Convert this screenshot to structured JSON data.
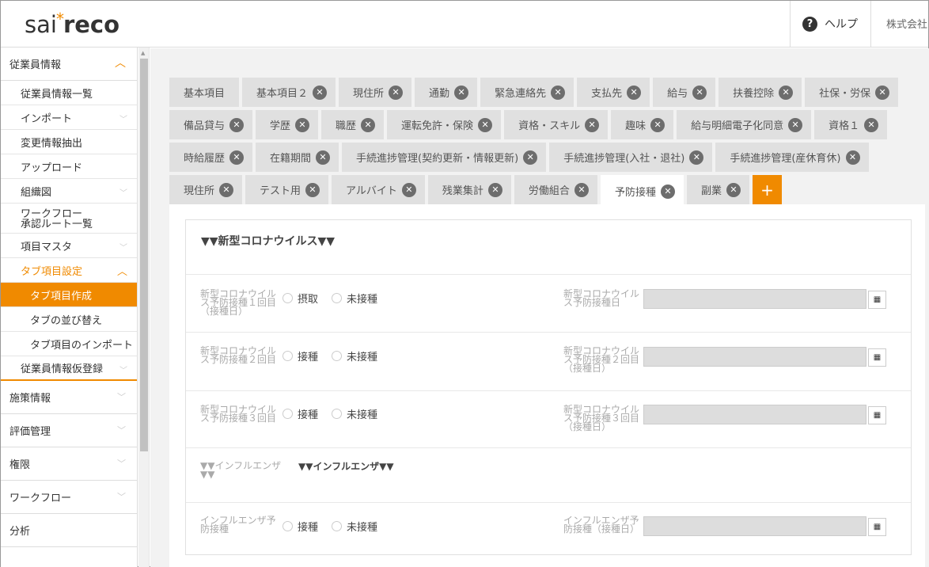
{
  "header": {
    "logo_light": "sai",
    "logo_star": "*",
    "logo_bold": "reco",
    "help_icon": "?",
    "help_label": "ヘルプ",
    "company": "株式会社"
  },
  "sidebar": {
    "group_employee": "従業員情報",
    "items": [
      "従業員情報一覧",
      "インポート",
      "変更情報抽出",
      "アップロード",
      "組織図",
      "ワークフロー\n承認ルート一覧",
      "項目マスタ",
      "タブ項目設定"
    ],
    "workflow_line1": "ワークフロー",
    "workflow_line2": "承認ルート一覧",
    "subitems": [
      "タブ項目作成",
      "タブの並び替え",
      "タブ項目のインポート"
    ],
    "temp_register": "従業員情報仮登録",
    "groups": [
      "施策情報",
      "評価管理",
      "権限",
      "ワークフロー",
      "分析"
    ]
  },
  "tabs": {
    "row1": [
      {
        "label": "基本項目",
        "closable": false
      },
      {
        "label": "基本項目２",
        "closable": true
      },
      {
        "label": "現住所",
        "closable": true
      },
      {
        "label": "通勤",
        "closable": true
      },
      {
        "label": "緊急連絡先",
        "closable": true
      },
      {
        "label": "支払先",
        "closable": true
      },
      {
        "label": "給与",
        "closable": true
      },
      {
        "label": "扶養控除",
        "closable": true
      },
      {
        "label": "社保・労保",
        "closable": true
      }
    ],
    "row2": [
      {
        "label": "備品貸与",
        "closable": true
      },
      {
        "label": "学歴",
        "closable": true
      },
      {
        "label": "職歴",
        "closable": true
      },
      {
        "label": "運転免許・保険",
        "closable": true
      },
      {
        "label": "資格・スキル",
        "closable": true
      },
      {
        "label": "趣味",
        "closable": true
      },
      {
        "label": "給与明細電子化同意",
        "closable": true
      },
      {
        "label": "資格１",
        "closable": true
      }
    ],
    "row3": [
      {
        "label": "時給履歴",
        "closable": true
      },
      {
        "label": "在籍期間",
        "closable": true
      },
      {
        "label": "手続進捗管理(契約更新・情報更新)",
        "closable": true
      },
      {
        "label": "手続進捗管理(入社・退社)",
        "closable": true
      },
      {
        "label": "手続進捗管理(産休育休)",
        "closable": true
      }
    ],
    "row4": [
      {
        "label": "現住所",
        "closable": true
      },
      {
        "label": "テスト用",
        "closable": true
      },
      {
        "label": "アルバイト",
        "closable": true
      },
      {
        "label": "残業集計",
        "closable": true
      },
      {
        "label": "労働組合",
        "closable": true
      },
      {
        "label": "予防接種",
        "closable": true,
        "active": true
      },
      {
        "label": "副業",
        "closable": true
      }
    ],
    "close_glyph": "✕",
    "add_glyph": "+"
  },
  "form": {
    "section_title": "▼▼新型コロナウイルス▼▼",
    "rows": [
      {
        "label": [
          "新型コロナウイル",
          "ス予防接種１回目",
          "（接種日）"
        ],
        "opt1": "摂取",
        "opt2": "未接種",
        "date_label": [
          "新型コロナウイル",
          "ス予防接種日"
        ]
      },
      {
        "label": [
          "新型コロナウイル",
          "ス予防接種２回目"
        ],
        "opt1": "接種",
        "opt2": "未接種",
        "date_label": [
          "新型コロナウイル",
          "ス予防接種２回目",
          "（接種日）"
        ]
      },
      {
        "label": [
          "新型コロナウイル",
          "ス予防接種３回目"
        ],
        "opt1": "接種",
        "opt2": "未接種",
        "date_label": [
          "新型コロナウイル",
          "ス予防接種３回目",
          "（接種日）"
        ]
      }
    ],
    "influenza_label": [
      "▼▼インフルエンザ",
      "▼▼"
    ],
    "influenza_title": "▼▼インフルエンザ▼▼",
    "flu_row": {
      "label": [
        "インフルエンザ予",
        "防接種"
      ],
      "opt1": "接種",
      "opt2": "未接種",
      "date_label": [
        "インフルエンザ予",
        "防接種（接種日）"
      ]
    },
    "calendar_icon": "▦"
  },
  "colors": {
    "accent": "#f08a00",
    "tab_bg": "#e0e0e0",
    "close_bg": "#6d6d6d"
  }
}
